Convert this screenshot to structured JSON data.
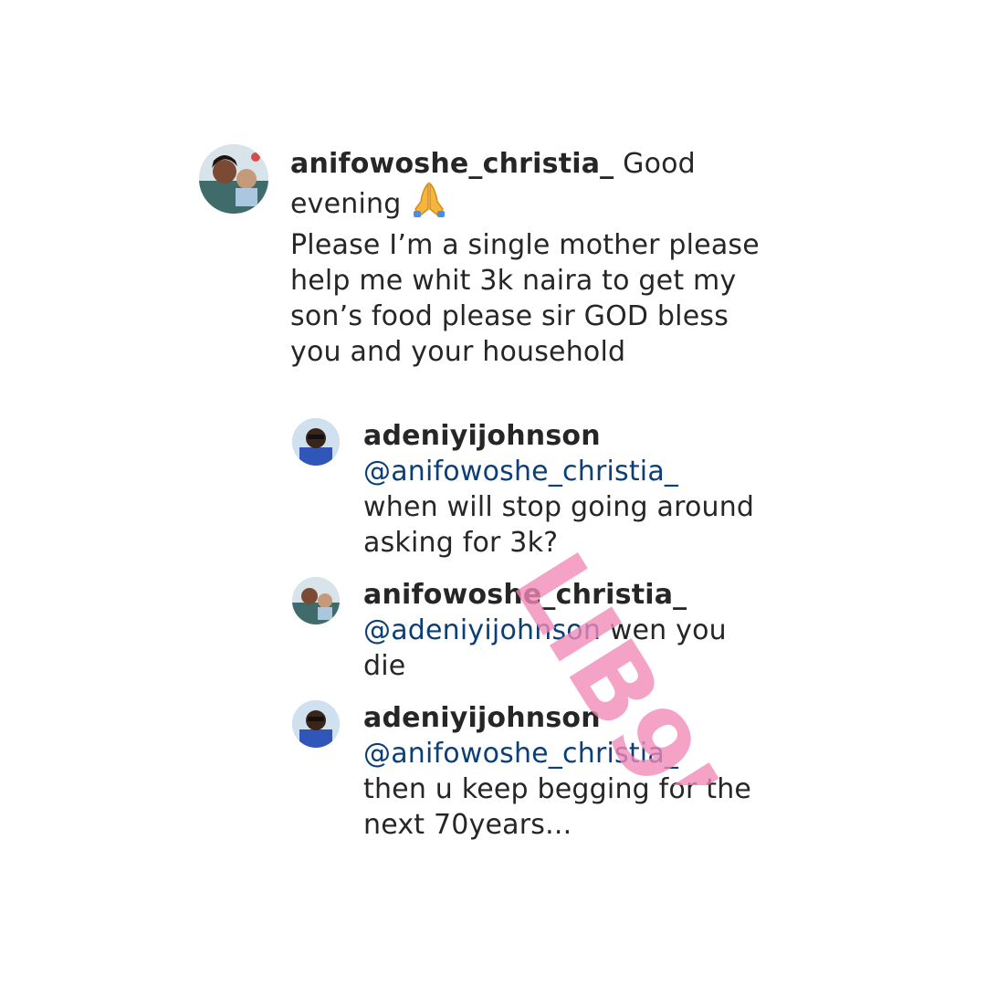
{
  "comments": {
    "main": {
      "username": "anifowoshe_christia_",
      "text_part1": " Good evening ",
      "emoji_icon": "praying-hands-icon",
      "text_part2": "Please I’m a single mother please help me whit 3k naira to get my son’s food please sir GOD bless you and your household"
    },
    "replies": [
      {
        "username": "adeniyijohnson",
        "mention": "@anifowoshe_christia_",
        "text": "when will stop going around asking for 3k?"
      },
      {
        "username": "anifowoshe_christia_",
        "mention": "@adeniyijohnson",
        "text": " wen you die"
      },
      {
        "username": "adeniyijohnson",
        "mention": "@anifowoshe_christia_",
        "text": "then u keep begging for the next 70years..."
      }
    ]
  },
  "watermark": {
    "text": "LIB9JA",
    "color": "#f28ab8"
  },
  "colors": {
    "text": "#262626",
    "mention": "#0c3f78",
    "background": "#ffffff"
  }
}
